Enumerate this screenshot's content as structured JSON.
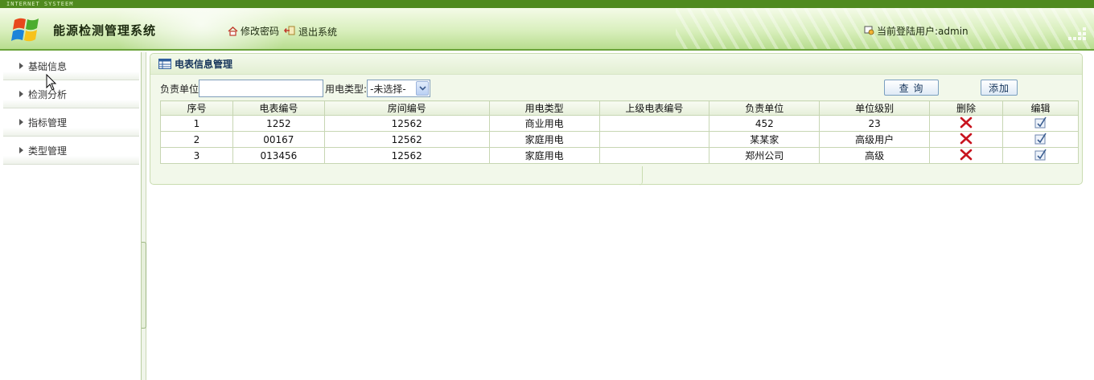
{
  "header": {
    "top_strip": "INTERNET SYSTEEM",
    "app_title": "能源检测管理系统",
    "links": [
      {
        "label": "修改密码",
        "icon": "home-icon"
      },
      {
        "label": "退出系统",
        "icon": "exit-icon"
      }
    ],
    "user_label": "当前登陆用户:admin"
  },
  "sidebar": {
    "items": [
      {
        "label": "基础信息"
      },
      {
        "label": "检测分析"
      },
      {
        "label": "指标管理"
      },
      {
        "label": "类型管理"
      }
    ]
  },
  "main": {
    "panel_title": "电表信息管理",
    "search": {
      "unit_label": "负责单位",
      "unit_value": "",
      "type_label": "用电类型:",
      "type_selected": "-未选择-",
      "query_button": "查 询",
      "add_button": "添加"
    },
    "table": {
      "columns": [
        "序号",
        "电表编号",
        "房间编号",
        "用电类型",
        "上级电表编号",
        "负责单位",
        "单位级别",
        "删除",
        "编辑"
      ],
      "rows": [
        {
          "no": "1",
          "meter": "1252",
          "room": "12562",
          "type": "商业用电",
          "parent": "",
          "unit": "452",
          "level": "23"
        },
        {
          "no": "2",
          "meter": "00167",
          "room": "12562",
          "type": "家庭用电",
          "parent": "",
          "unit": "某某家",
          "level": "高级用户"
        },
        {
          "no": "3",
          "meter": "013456",
          "room": "12562",
          "type": "家庭用电",
          "parent": "",
          "unit": "郑州公司",
          "level": "高级"
        }
      ]
    }
  },
  "colors": {
    "header_green": "#b8dd8f",
    "title_blue": "#15345a",
    "delete_red": "#c8141e"
  }
}
